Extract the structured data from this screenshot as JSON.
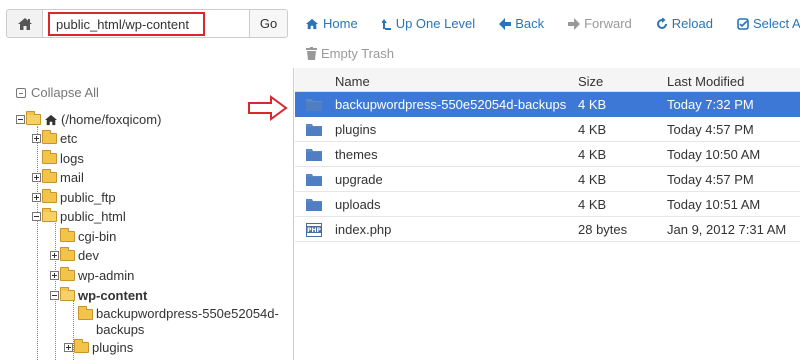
{
  "address_bar": {
    "path_value": "public_html/wp-content",
    "go_label": "Go"
  },
  "toolbar": {
    "home": "Home",
    "up_one_level": "Up One Level",
    "back": "Back",
    "forward": "Forward",
    "reload": "Reload",
    "select_all": "Select All",
    "empty_trash": "Empty Trash"
  },
  "tree": {
    "collapse_all": "Collapse All",
    "root": "(/home/foxqicom)",
    "items": {
      "etc": "etc",
      "logs": "logs",
      "mail": "mail",
      "public_ftp": "public_ftp",
      "public_html": "public_html",
      "cgi_bin": "cgi-bin",
      "dev": "dev",
      "wp_admin": "wp-admin",
      "wp_content": "wp-content",
      "backup_line1": "backupwordpress-550e52054d-",
      "backup_line2": "backups",
      "plugins": "plugins"
    }
  },
  "file_table": {
    "headers": {
      "name": "Name",
      "size": "Size",
      "modified": "Last Modified"
    },
    "rows": [
      {
        "name": "backupwordpress-550e52054d-backups",
        "size": "4 KB",
        "modified": "Today 7:32 PM",
        "type": "folder"
      },
      {
        "name": "plugins",
        "size": "4 KB",
        "modified": "Today 4:57 PM",
        "type": "folder"
      },
      {
        "name": "themes",
        "size": "4 KB",
        "modified": "Today 10:50 AM",
        "type": "folder"
      },
      {
        "name": "upgrade",
        "size": "4 KB",
        "modified": "Today 4:57 PM",
        "type": "folder"
      },
      {
        "name": "uploads",
        "size": "4 KB",
        "modified": "Today 10:51 AM",
        "type": "folder"
      },
      {
        "name": "index.php",
        "size": "28 bytes",
        "modified": "Jan 9, 2012 7:31 AM",
        "type": "php"
      }
    ]
  },
  "colors": {
    "link_blue": "#2a74b9",
    "selected_row": "#3d78d6",
    "highlight_red": "#d9272e",
    "folder_yellow": "#f2c449",
    "folder_blue": "#5b87c5"
  }
}
